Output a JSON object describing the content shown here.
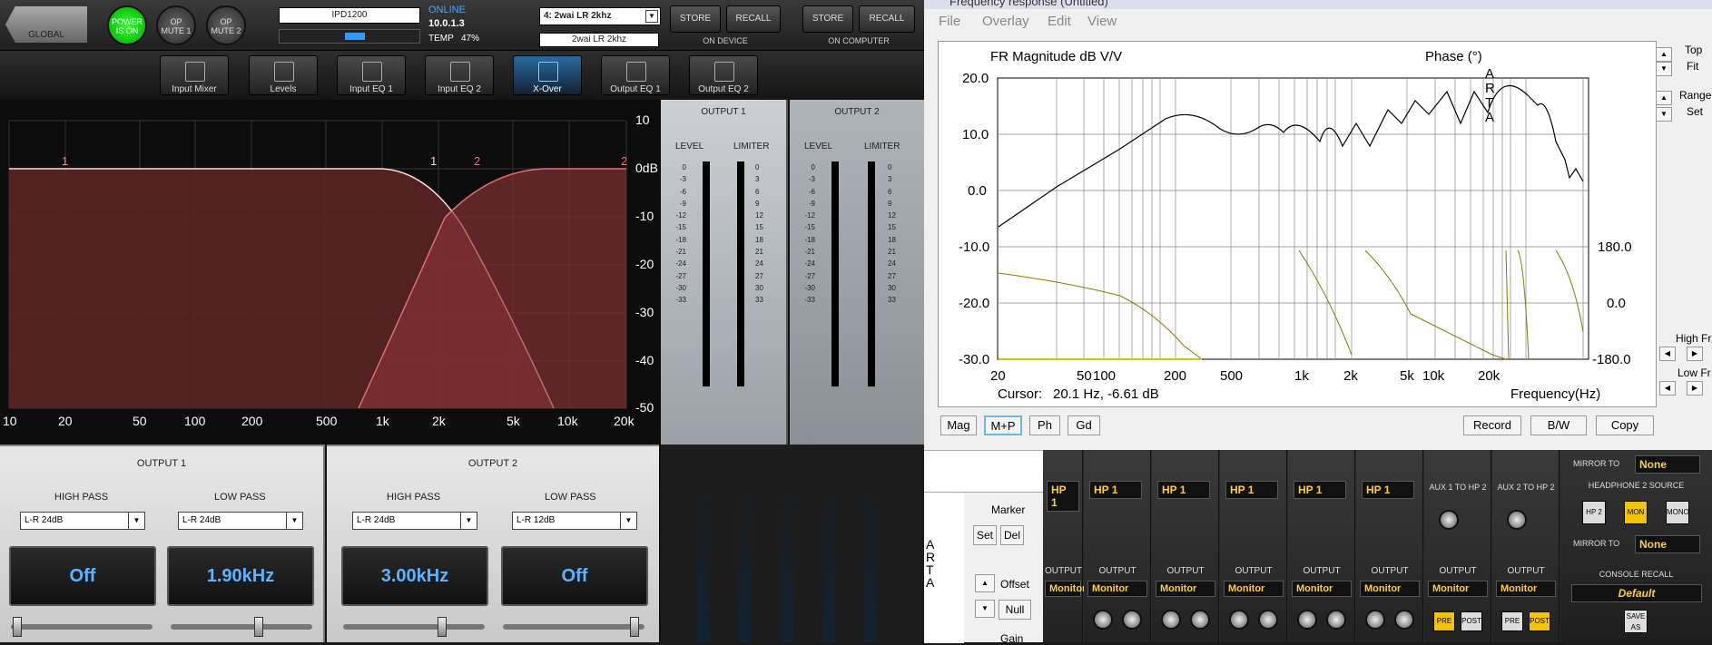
{
  "left": {
    "global_label": "GLOBAL",
    "power_label": "POWER IS ON",
    "op_mute1": "OP MUTE 1",
    "op_mute2": "OP MUTE 2",
    "device_name": "IPD1200",
    "online": "ONLINE",
    "ip": "10.0.1.3",
    "temp_label": "TEMP",
    "temp_value": "47%",
    "preset_select": "4: 2wai LR 2khz",
    "preset_name": "2wai LR 2khz",
    "store": "STORE",
    "recall": "RECALL",
    "on_device": "ON DEVICE",
    "on_computer": "ON COMPUTER",
    "tools": [
      "Input Mixer",
      "Levels",
      "Input EQ 1",
      "Input EQ 2",
      "X-Over",
      "Output EQ 1",
      "Output EQ 2"
    ],
    "graph": {
      "x_ticks": [
        "10",
        "20",
        "50",
        "100",
        "200",
        "500",
        "1k",
        "2k",
        "5k",
        "10k",
        "20k"
      ],
      "y_ticks": [
        "10",
        "0dB",
        "-10",
        "-20",
        "-30",
        "-40",
        "-50"
      ],
      "markers": [
        "1",
        "1",
        "2",
        "2"
      ]
    },
    "meters": {
      "out1_title": "OUTPUT 1",
      "out2_title": "OUTPUT 2",
      "level": "LEVEL",
      "limiter": "LIMITER",
      "level_scale": [
        "0",
        "-3",
        "-6",
        "-9",
        "-12",
        "-15",
        "-18",
        "-21",
        "-24",
        "-27",
        "-30",
        "-33"
      ],
      "limiter_scale": [
        "0",
        "3",
        "6",
        "9",
        "12",
        "15",
        "18",
        "21",
        "24",
        "27",
        "30",
        "33"
      ]
    },
    "out1": {
      "title": "OUTPUT 1",
      "hp_label": "HIGH PASS",
      "lp_label": "LOW PASS",
      "hp_type": "L-R 24dB",
      "lp_type": "L-R 24dB",
      "hp_value": "Off",
      "lp_value": "1.90kHz"
    },
    "out2": {
      "title": "OUTPUT 2",
      "hp_label": "HIGH PASS",
      "lp_label": "LOW PASS",
      "hp_type": "L-R 24dB",
      "lp_type": "L-R 12dB",
      "hp_value": "3.00kHz",
      "lp_value": "Off"
    }
  },
  "right": {
    "title": "Frequency response (Untitled)",
    "menu": [
      "File",
      "Overlay",
      "Edit",
      "View"
    ],
    "plot_title": "FR Magnitude dB V/V",
    "phase_label": "Phase (°)",
    "arta": [
      "A",
      "R",
      "T",
      "A"
    ],
    "y_left_ticks": [
      "20.0",
      "10.0",
      "0.0",
      "-10.0",
      "-20.0",
      "-30.0"
    ],
    "y_right_ticks": [
      "180.0",
      "0.0",
      "-180.0"
    ],
    "x_ticks": [
      "20",
      "50",
      "100",
      "200",
      "500",
      "1k",
      "2k",
      "5k",
      "10k",
      "20k"
    ],
    "cursor_label": "Cursor:",
    "cursor_value": "20.1 Hz, -6.61 dB",
    "freq_label": "Frequency(Hz)",
    "buttons": [
      "Mag",
      "M+P",
      "Ph",
      "Gd"
    ],
    "record": "Record",
    "bw": "B/W",
    "copy": "Copy",
    "top_label": "Top",
    "fit_label": "Fit",
    "range_label": "Range",
    "set_label": "Set",
    "high_fr": "High Fr",
    "low_fr": "Low Fr",
    "marker_label": "Marker",
    "set_btn": "Set",
    "del_btn": "Del",
    "offset_label": "Offset",
    "null_btn": "Null",
    "gain_label": "Gain",
    "arta_side": [
      "A",
      "R",
      "T",
      "A"
    ]
  },
  "mixer": {
    "strip_select": "HP 1",
    "output_label": "OUTPUT",
    "monitor": "Monitor",
    "aux1": "AUX 1 TO HP 2",
    "aux2": "AUX 2 TO HP 2",
    "mirror_to": "MIRROR TO",
    "none": "None",
    "hp2_source": "HEADPHONE 2 SOURCE",
    "hp2": "HP 2",
    "mon": "MON",
    "mono": "MONO",
    "console_recall": "CONSOLE RECALL",
    "default": "Default",
    "save_as": "SAVE AS",
    "pre": "PRE",
    "post": "POST"
  }
}
